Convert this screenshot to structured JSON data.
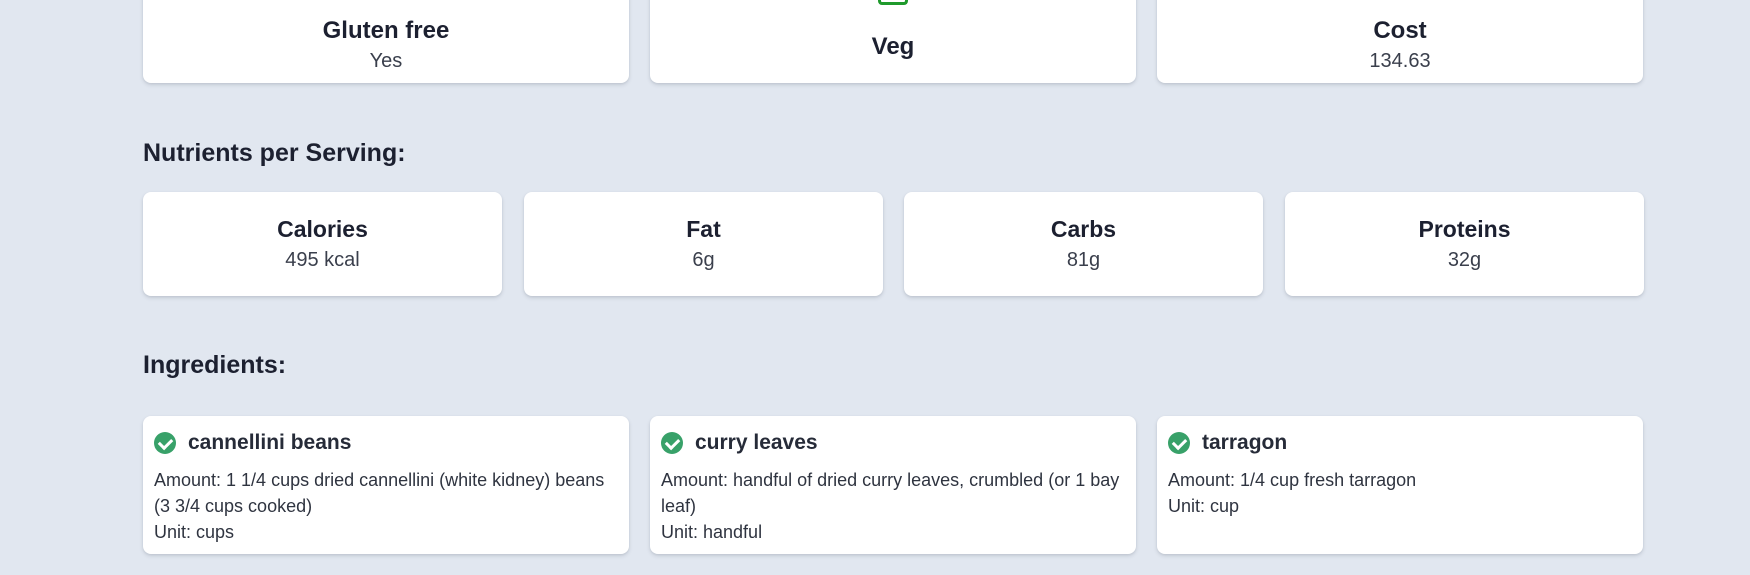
{
  "summary": {
    "gluten_free": {
      "title": "Gluten free",
      "value": "Yes"
    },
    "veg": {
      "title": "Veg",
      "icon": "veg-icon"
    },
    "cost": {
      "title": "Cost",
      "value": "134.63"
    }
  },
  "nutrients": {
    "heading": "Nutrients per Serving:",
    "items": [
      {
        "title": "Calories",
        "value": "495 kcal"
      },
      {
        "title": "Fat",
        "value": "6g"
      },
      {
        "title": "Carbs",
        "value": "81g"
      },
      {
        "title": "Proteins",
        "value": "32g"
      }
    ]
  },
  "ingredients": {
    "heading": "Ingredients:",
    "items": [
      {
        "name": "cannellini beans",
        "amount": "Amount: 1 1/4 cups dried cannellini (white kidney) beans (3 3/4 cups cooked)",
        "unit": "Unit: cups"
      },
      {
        "name": "curry leaves",
        "amount": "Amount: handful of dried curry leaves, crumbled (or 1 bay leaf)",
        "unit": "Unit: handful"
      },
      {
        "name": "tarragon",
        "amount": "Amount: 1/4 cup fresh tarragon",
        "unit": "Unit: cup"
      }
    ]
  },
  "colors": {
    "background": "#e1e7f0",
    "card": "#ffffff",
    "veg_green": "#1f9a2c",
    "check_green": "#38a169"
  }
}
